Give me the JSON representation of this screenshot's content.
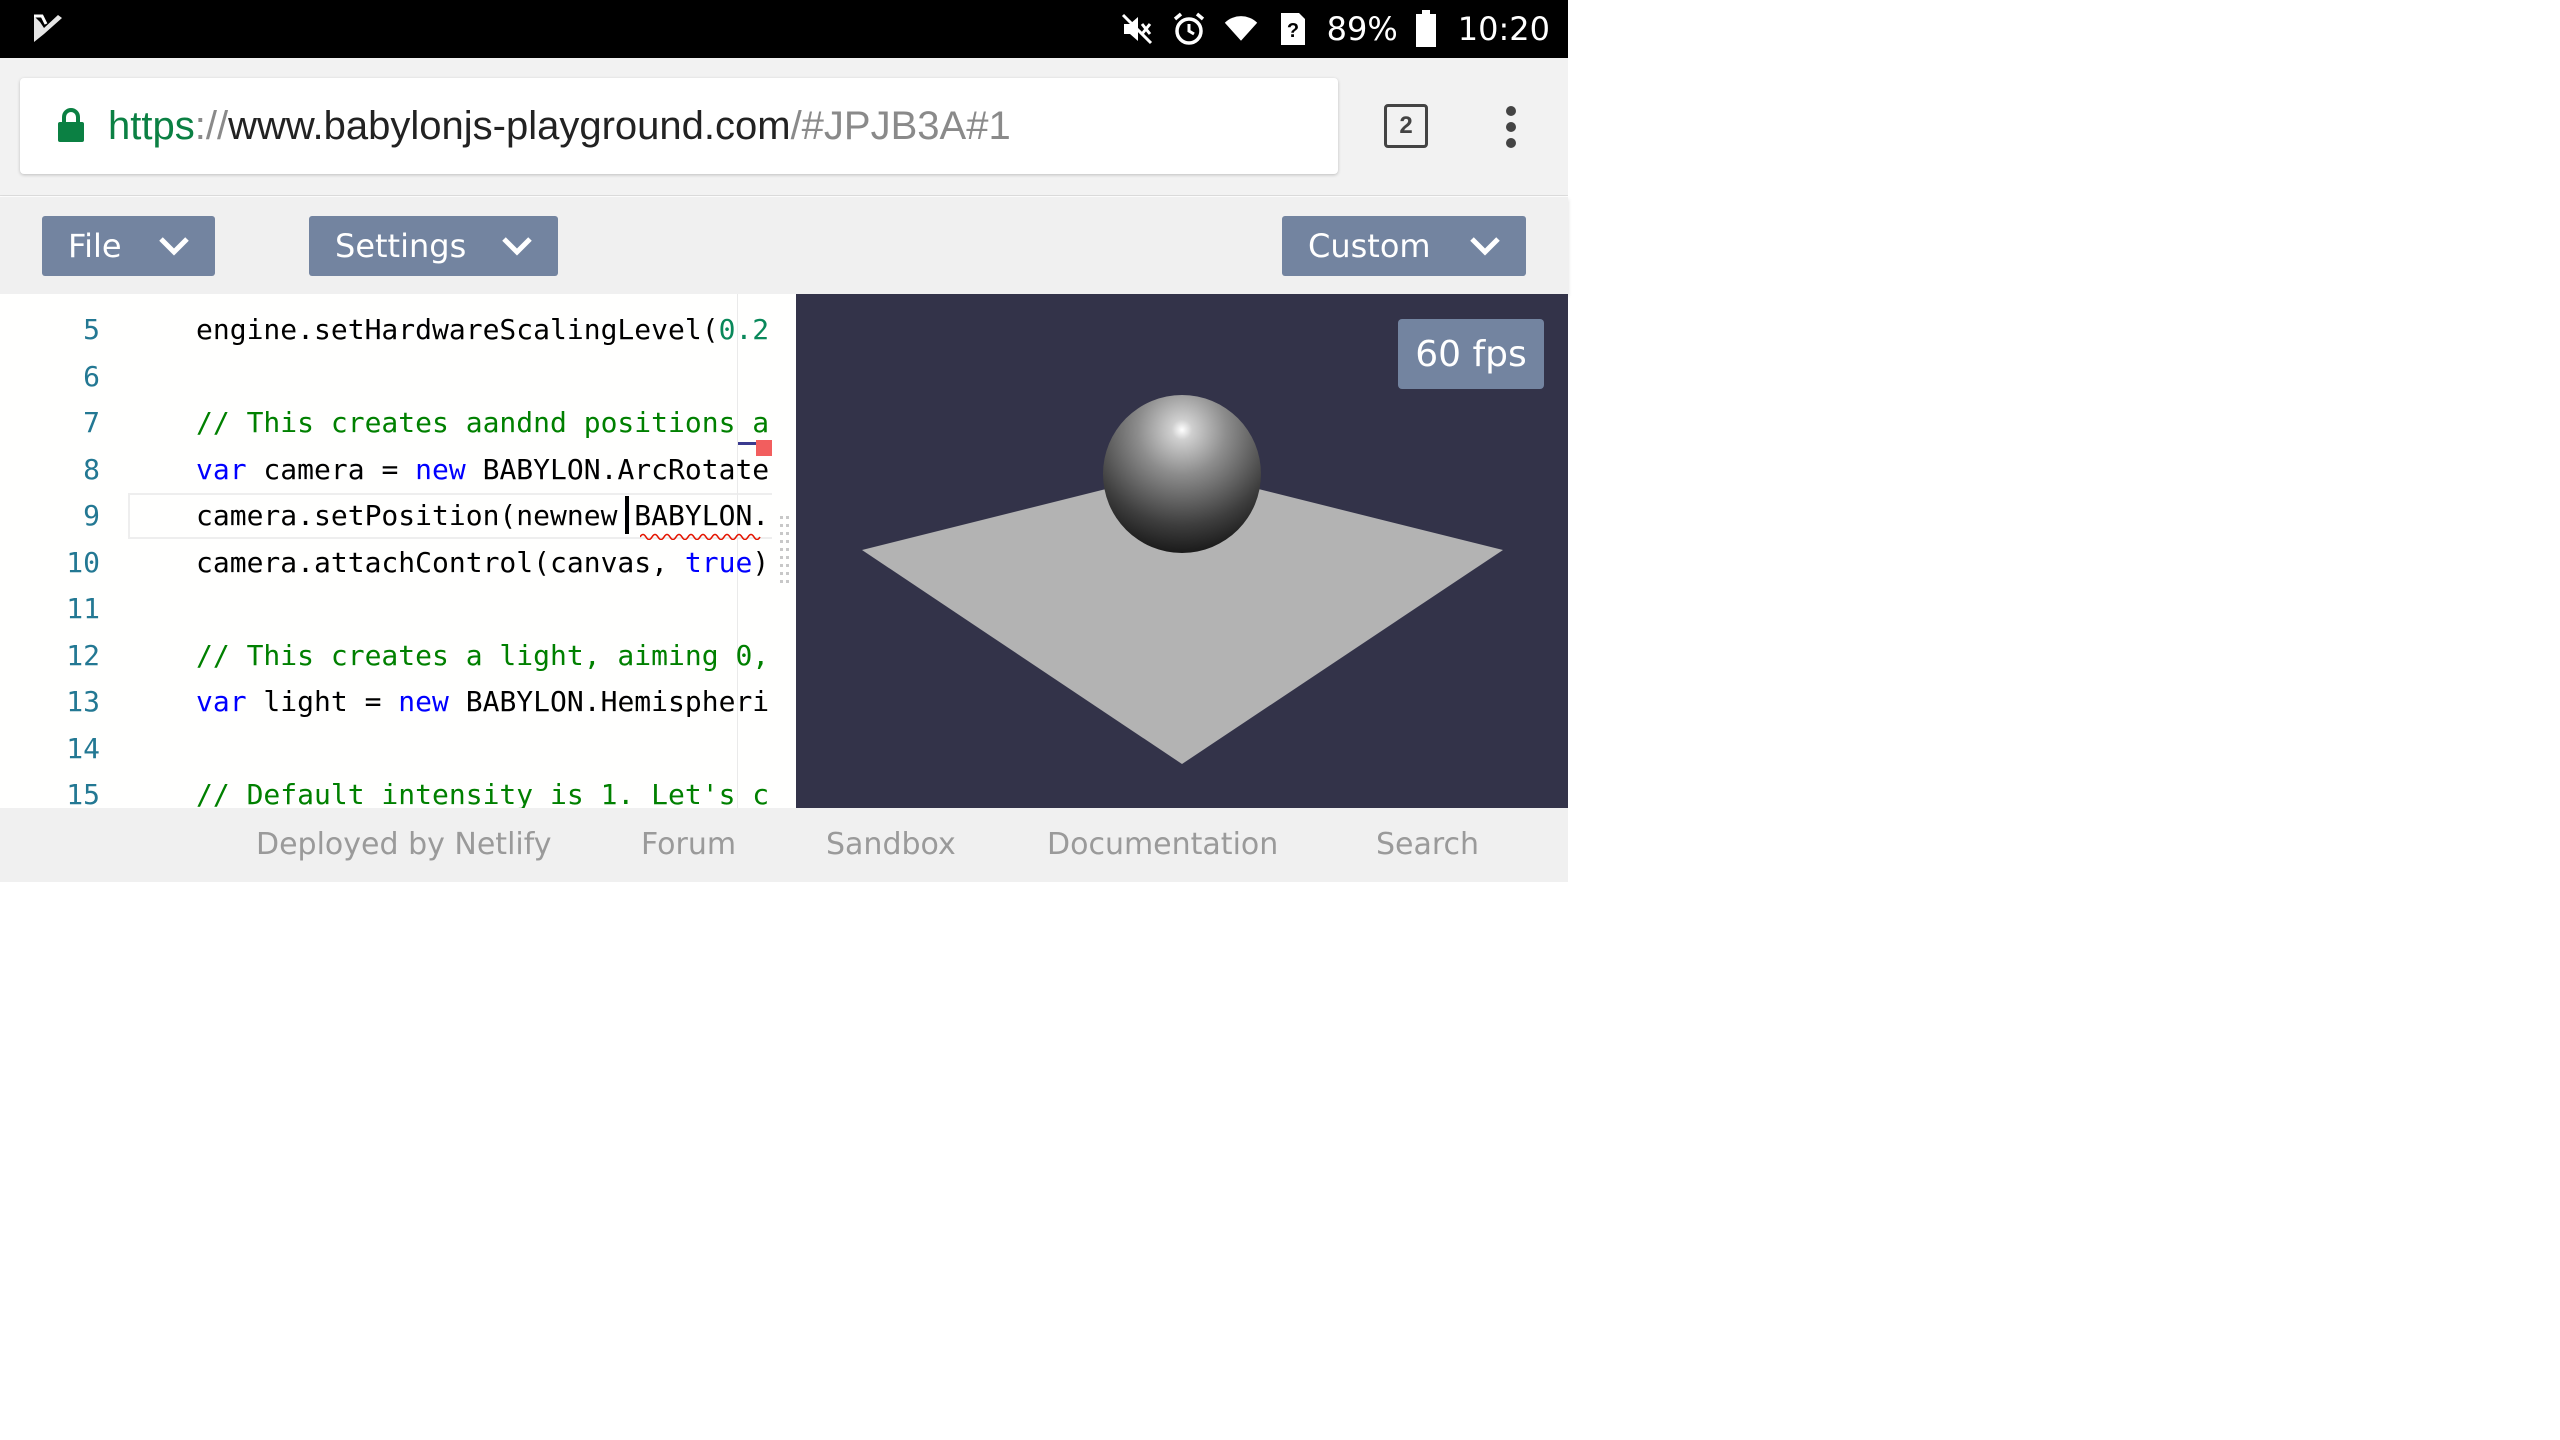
{
  "status_bar": {
    "battery": "89%",
    "time": "10:20",
    "icons": [
      "app-logo-icon",
      "mute-icon",
      "alarm-icon",
      "wifi-icon",
      "no-sim-icon",
      "battery-icon"
    ],
    "sim_badge": "?"
  },
  "browser": {
    "url": {
      "scheme": "https",
      "separator": "://",
      "host": "www.babylonjs-playground.com",
      "path": "/#JPJB3A#1"
    },
    "tab_count": "2",
    "colors": {
      "secure_scheme": "#0b8043"
    }
  },
  "toolbar": {
    "file_label": "File",
    "settings_label": "Settings",
    "custom_label": "Custom",
    "button_color": "#7384a0"
  },
  "editor": {
    "lines": [
      {
        "num": "5",
        "tokens": [
          {
            "t": "engine.setHardwareScalingLevel(",
            "c": ""
          },
          {
            "t": "0.2",
            "c": "num"
          }
        ]
      },
      {
        "num": "6",
        "tokens": []
      },
      {
        "num": "7",
        "tokens": [
          {
            "t": "// This creates aandnd positions a",
            "c": "cm"
          }
        ]
      },
      {
        "num": "8",
        "tokens": [
          {
            "t": "var",
            "c": "kw"
          },
          {
            "t": " camera = ",
            "c": ""
          },
          {
            "t": "new",
            "c": "kw"
          },
          {
            "t": " BABYLON.ArcRotate",
            "c": ""
          }
        ]
      },
      {
        "num": "9",
        "tokens": [
          {
            "t": "camera.setPosition(newnew",
            "c": ""
          },
          {
            "t": " BABYLON.",
            "c": ""
          }
        ]
      },
      {
        "num": "10",
        "tokens": [
          {
            "t": "camera.attachControl(canvas, ",
            "c": ""
          },
          {
            "t": "true",
            "c": "kw"
          },
          {
            "t": ")",
            "c": ""
          }
        ]
      },
      {
        "num": "11",
        "tokens": []
      },
      {
        "num": "12",
        "tokens": [
          {
            "t": "// This creates a light, aiming 0,",
            "c": "cm"
          }
        ]
      },
      {
        "num": "13",
        "tokens": [
          {
            "t": "var",
            "c": "kw"
          },
          {
            "t": " light = ",
            "c": ""
          },
          {
            "t": "new",
            "c": "kw"
          },
          {
            "t": " BABYLON.Hemispheri",
            "c": ""
          }
        ]
      },
      {
        "num": "14",
        "tokens": []
      },
      {
        "num": "15",
        "tokens": [
          {
            "t": "// Default intensity is 1. Let's c",
            "c": "cm"
          }
        ]
      }
    ],
    "colors": {
      "keyword": "#0000ff",
      "comment": "#008000",
      "number": "#09885a",
      "line_number": "#237893"
    }
  },
  "canvas": {
    "fps": "60 fps",
    "background": "#333349",
    "ground_color": "#b3b3b3"
  },
  "footer": {
    "links": [
      "Deployed by Netlify",
      "Forum",
      "Sandbox",
      "Documentation",
      "Search"
    ]
  }
}
